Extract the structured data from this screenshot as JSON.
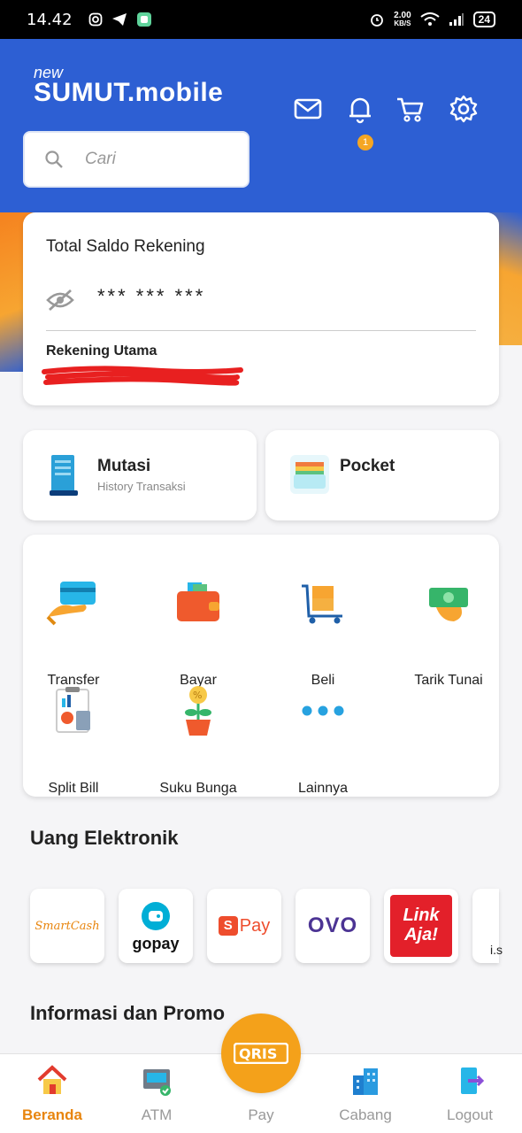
{
  "status_bar": {
    "time": "14.42",
    "network_speed_value": "2.00",
    "network_speed_unit": "KB/S",
    "battery": "24"
  },
  "app": {
    "logo_prefix": "new",
    "logo_main": "SUMUT.",
    "logo_suffix": "mobile"
  },
  "search": {
    "placeholder": "Cari"
  },
  "header_icons": {
    "notification_count": "1"
  },
  "balance_card": {
    "title": "Total Saldo Rekening",
    "masked_balance": "*** *** ***",
    "account_label": "Rekening Utama"
  },
  "quick_cards": [
    {
      "label": "Mutasi",
      "sublabel": "History Transaksi"
    },
    {
      "label": "Pocket"
    }
  ],
  "menu": [
    {
      "label": "Transfer"
    },
    {
      "label": "Bayar"
    },
    {
      "label": "Beli"
    },
    {
      "label": "Tarik Tunai"
    },
    {
      "label": "Split Bill"
    },
    {
      "label": "Suku Bunga"
    },
    {
      "label": "Lainnya"
    }
  ],
  "ewallet_section": {
    "title": "Uang Elektronik",
    "items": [
      {
        "label": "SmartCash"
      },
      {
        "label": "gopay"
      },
      {
        "label": "Pay"
      },
      {
        "label": "OVO"
      },
      {
        "label_line1": "Link",
        "label_line2": "Aja!"
      },
      {
        "label": "i.s"
      }
    ]
  },
  "promo_section": {
    "title": "Informasi dan Promo"
  },
  "bottom_nav": [
    {
      "label": "Beranda"
    },
    {
      "label": "ATM"
    },
    {
      "label": "Pay"
    },
    {
      "label": "Cabang"
    },
    {
      "label": "Logout"
    }
  ],
  "qris_label": "QRIS",
  "colors": {
    "header_blue": "#2d5fd3",
    "accent_orange": "#e8850e",
    "qris_orange": "#f4a11a"
  }
}
